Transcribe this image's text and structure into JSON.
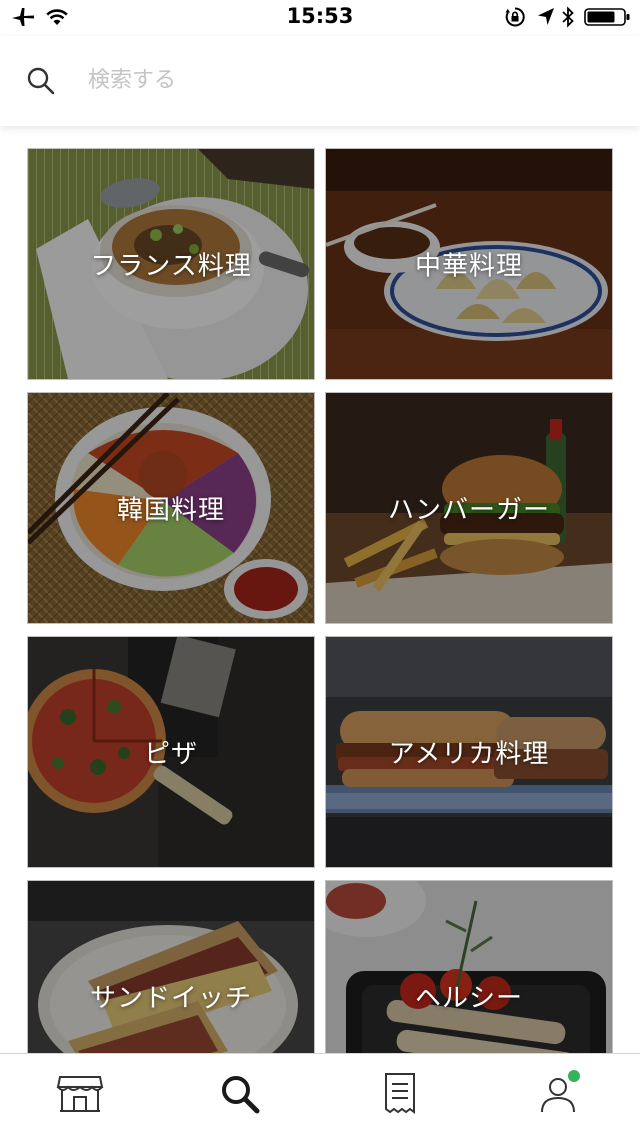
{
  "status_bar": {
    "time": "15:53",
    "icons": [
      "airplane-icon",
      "wifi-icon",
      "orientation-lock-icon",
      "location-arrow-icon",
      "bluetooth-icon",
      "battery-icon"
    ]
  },
  "search": {
    "placeholder": "検索する",
    "value": "",
    "icon": "search-icon"
  },
  "categories": [
    {
      "label": "フランス料理"
    },
    {
      "label": "中華料理"
    },
    {
      "label": "韓国料理"
    },
    {
      "label": "ハンバーガー"
    },
    {
      "label": "ピザ"
    },
    {
      "label": "アメリカ料理"
    },
    {
      "label": "サンドイッチ"
    },
    {
      "label": "ヘルシー"
    }
  ],
  "tab_bar": {
    "tabs": [
      {
        "icon": "store-icon",
        "active": false
      },
      {
        "icon": "search-icon",
        "active": true
      },
      {
        "icon": "receipt-icon",
        "active": false
      },
      {
        "icon": "account-icon",
        "active": false,
        "badge": true
      }
    ],
    "badge_color": "#34b35a"
  }
}
